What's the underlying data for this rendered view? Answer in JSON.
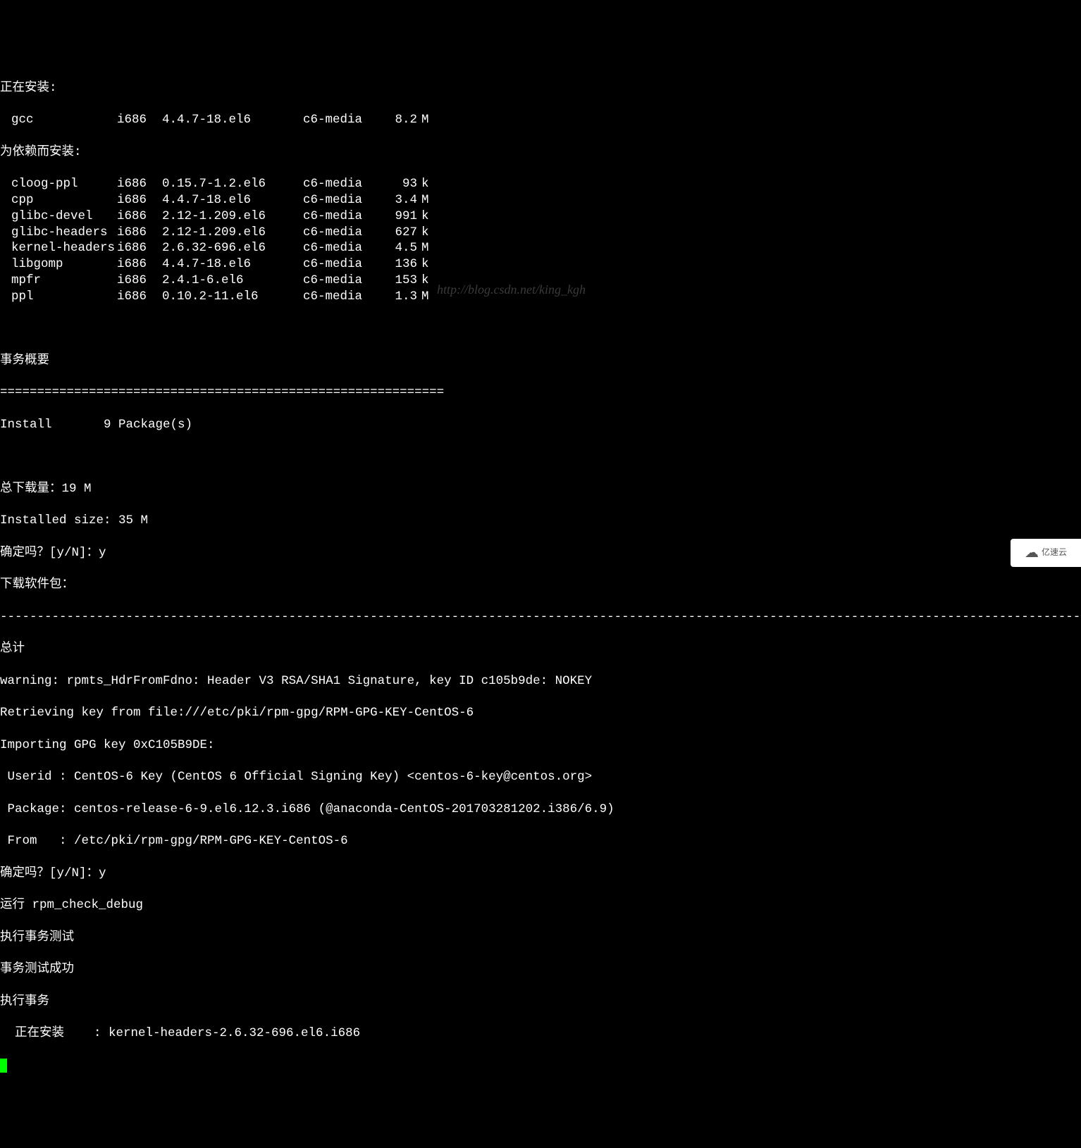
{
  "header_installing": "正在安装:",
  "header_deps": "为依赖而安装:",
  "main_pkg": {
    "name": "gcc",
    "arch": "i686",
    "ver": "4.4.7-18.el6",
    "repo": "c6-media",
    "size": "8.2",
    "unit": "M"
  },
  "deps": [
    {
      "name": "cloog-ppl",
      "arch": "i686",
      "ver": "0.15.7-1.2.el6",
      "repo": "c6-media",
      "size": "93",
      "unit": "k"
    },
    {
      "name": "cpp",
      "arch": "i686",
      "ver": "4.4.7-18.el6",
      "repo": "c6-media",
      "size": "3.4",
      "unit": "M"
    },
    {
      "name": "glibc-devel",
      "arch": "i686",
      "ver": "2.12-1.209.el6",
      "repo": "c6-media",
      "size": "991",
      "unit": "k"
    },
    {
      "name": "glibc-headers",
      "arch": "i686",
      "ver": "2.12-1.209.el6",
      "repo": "c6-media",
      "size": "627",
      "unit": "k"
    },
    {
      "name": "kernel-headers",
      "arch": "i686",
      "ver": "2.6.32-696.el6",
      "repo": "c6-media",
      "size": "4.5",
      "unit": "M"
    },
    {
      "name": "libgomp",
      "arch": "i686",
      "ver": "4.4.7-18.el6",
      "repo": "c6-media",
      "size": "136",
      "unit": "k"
    },
    {
      "name": "mpfr",
      "arch": "i686",
      "ver": "2.4.1-6.el6",
      "repo": "c6-media",
      "size": "153",
      "unit": "k"
    },
    {
      "name": "ppl",
      "arch": "i686",
      "ver": "0.10.2-11.el6",
      "repo": "c6-media",
      "size": "1.3",
      "unit": "M"
    }
  ],
  "summary_title": "事务概要",
  "separator_eq": "============================================================",
  "install_line": "Install       9 Package(s)",
  "total_dl": "总下载量：19 M",
  "installed_size": "Installed size: 35 M",
  "confirm_prompt": "确定吗？[y/N]：y",
  "downloading": "下载软件包：",
  "dash_sep": "--------------------------------------------------------------------------------------------------------------------------------------------------------",
  "total": "总计",
  "warning": "warning: rpmts_HdrFromFdno: Header V3 RSA/SHA1 Signature, key ID c105b9de: NOKEY",
  "retrieving": "Retrieving key from file:///etc/pki/rpm-gpg/RPM-GPG-KEY-CentOS-6",
  "importing": "Importing GPG key 0xC105B9DE:",
  "userid": " Userid : CentOS-6 Key (CentOS 6 Official Signing Key) <centos-6-key@centos.org>",
  "package": " Package: centos-release-6-9.el6.12.3.i686 (@anaconda-CentOS-201703281202.i386/6.9)",
  "from": " From   : /etc/pki/rpm-gpg/RPM-GPG-KEY-CentOS-6",
  "confirm2": "确定吗？[y/N]：y",
  "run_check": "运行 rpm_check_debug",
  "exec_test": "执行事务测试",
  "test_success": "事务测试成功",
  "exec_trans": "执行事务",
  "installing_pkg": "  正在安装    : kernel-headers-2.6.32-696.el6.i686",
  "watermark": "http://blog.csdn.net/king_kgh",
  "logo_text": "亿速云"
}
